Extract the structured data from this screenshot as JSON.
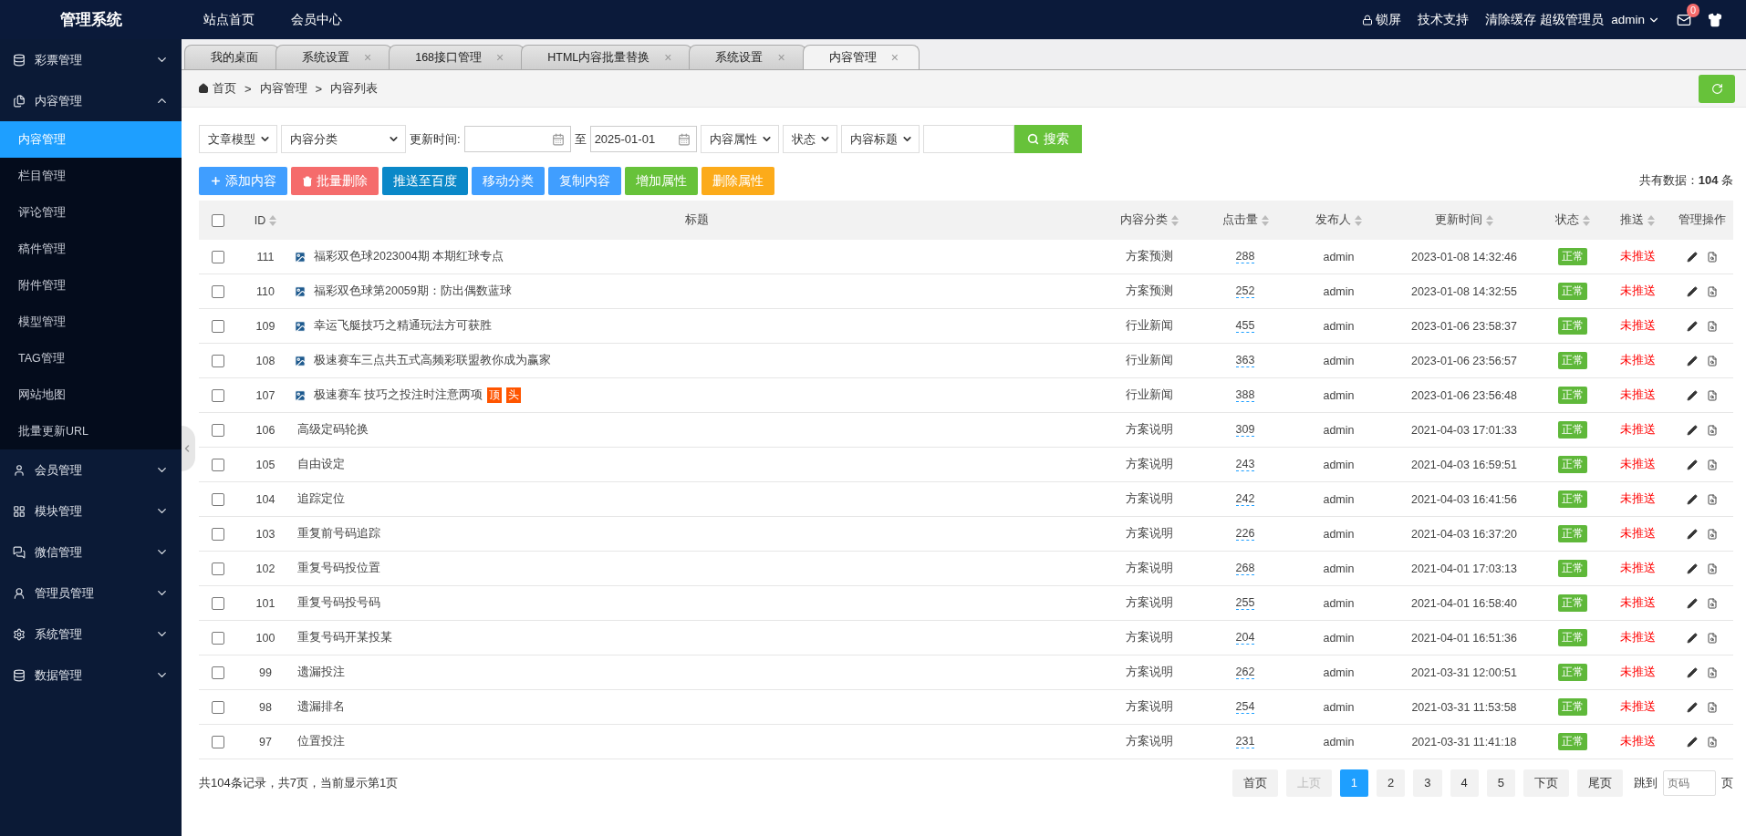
{
  "header": {
    "logo": "管理系统",
    "nav": [
      "站点首页",
      "会员中心"
    ],
    "lock": "锁屏",
    "links": [
      "技术支持",
      "清除缓存"
    ],
    "role": "超级管理员",
    "user": "admin",
    "mail_count": "0"
  },
  "sidebar": {
    "items": [
      {
        "label": "彩票管理",
        "expanded": false
      },
      {
        "label": "内容管理",
        "expanded": true,
        "children": [
          {
            "label": "内容管理",
            "selected": true
          },
          {
            "label": "栏目管理",
            "selected": false
          },
          {
            "label": "评论管理",
            "selected": false
          },
          {
            "label": "稿件管理",
            "selected": false
          },
          {
            "label": "附件管理",
            "selected": false
          },
          {
            "label": "模型管理",
            "selected": false
          },
          {
            "label": "TAG管理",
            "selected": false
          },
          {
            "label": "网站地图",
            "selected": false
          },
          {
            "label": "批量更新URL",
            "selected": false
          }
        ]
      },
      {
        "label": "会员管理",
        "expanded": false
      },
      {
        "label": "模块管理",
        "expanded": false
      },
      {
        "label": "微信管理",
        "expanded": false
      },
      {
        "label": "管理员管理",
        "expanded": false
      },
      {
        "label": "系统管理",
        "expanded": false
      },
      {
        "label": "数据管理",
        "expanded": false
      }
    ]
  },
  "tabs": [
    {
      "label": "我的桌面",
      "selected": false
    },
    {
      "label": "系统设置",
      "close": "×",
      "selected": false
    },
    {
      "label": "168接口管理",
      "close": "×",
      "selected": false
    },
    {
      "label": "HTML内容批量替换",
      "close": "×",
      "selected": false
    },
    {
      "label": "系统设置",
      "close": "×",
      "selected": false
    },
    {
      "label": "内容管理",
      "close": "×",
      "selected": true
    }
  ],
  "breadcrumb": {
    "items": [
      "首页",
      "内容管理",
      "内容列表"
    ],
    "separator": ">"
  },
  "filters": [
    {
      "kind": "select",
      "value": "文章模型",
      "wide": false
    },
    {
      "kind": "select",
      "value": "内容分类",
      "wide": true
    },
    {
      "kind": "label",
      "text": "更新时间:"
    },
    {
      "kind": "date"
    },
    {
      "kind": "label",
      "text": "至"
    },
    {
      "kind": "date",
      "value": "2025-01-01"
    },
    {
      "kind": "select",
      "value": "内容属性",
      "wide": false
    },
    {
      "kind": "select",
      "value": "状态",
      "wide": false
    },
    {
      "kind": "select",
      "value": "内容标题",
      "wide": false
    },
    {
      "kind": "text"
    },
    {
      "kind": "button",
      "label": "搜索"
    }
  ],
  "actions": [
    {
      "label": "添加内容",
      "kind": "add",
      "color": "#409eff"
    },
    {
      "label": "批量删除",
      "kind": "delete",
      "color": "#f56c6c"
    },
    {
      "label": "推送至百度",
      "kind": "plain",
      "color": "#0a88c8"
    },
    {
      "label": "移动分类",
      "kind": "plain",
      "color": "#409eff"
    },
    {
      "label": "复制内容",
      "kind": "plain",
      "color": "#409eff"
    },
    {
      "label": "增加属性",
      "kind": "plain",
      "color": "#67c23a"
    },
    {
      "label": "删除属性",
      "kind": "plain",
      "color": "#fcab1a"
    }
  ],
  "total": "共有数据：**104** 条",
  "table": {
    "select_all": false,
    "columns": [
      {
        "label": "ID",
        "sortable": true
      },
      {
        "label": "标题",
        "sortable": false
      },
      {
        "label": "内容分类",
        "sortable": true
      },
      {
        "label": "点击量",
        "sortable": true
      },
      {
        "label": "发布人",
        "sortable": true
      },
      {
        "label": "更新时间",
        "sortable": true
      },
      {
        "label": "状态",
        "sortable": true
      },
      {
        "label": "推送",
        "sortable": true
      },
      {
        "label": "管理操作",
        "sortable": false
      }
    ],
    "rows": [
      {
        "checked": false,
        "id": "111",
        "has_image": true,
        "title": "福彩双色球2023004期 本期红球专点",
        "category": "方案预测",
        "clicks": "288",
        "author": "admin",
        "updated": "2023-01-08 14:32:46",
        "status": "正常",
        "push": "未推送"
      },
      {
        "checked": false,
        "id": "110",
        "has_image": true,
        "title": "福彩双色球第20059期：防出偶数蓝球",
        "category": "方案预测",
        "clicks": "252",
        "author": "admin",
        "updated": "2023-01-08 14:32:55",
        "status": "正常",
        "push": "未推送"
      },
      {
        "checked": false,
        "id": "109",
        "has_image": true,
        "title": "幸运飞艇技巧之精通玩法方可获胜",
        "category": "行业新闻",
        "clicks": "455",
        "author": "admin",
        "updated": "2023-01-06 23:58:37",
        "status": "正常",
        "push": "未推送"
      },
      {
        "checked": false,
        "id": "108",
        "has_image": true,
        "title": "极速赛车三点共五式高频彩联盟教你成为赢家",
        "category": "行业新闻",
        "clicks": "363",
        "author": "admin",
        "updated": "2023-01-06 23:56:57",
        "status": "正常",
        "push": "未推送"
      },
      {
        "checked": false,
        "id": "107",
        "has_image": true,
        "title": "极速赛车 技巧之投注时注意两项",
        "tags": [
          "顶",
          "头"
        ],
        "category": "行业新闻",
        "clicks": "388",
        "author": "admin",
        "updated": "2023-01-06 23:56:48",
        "status": "正常",
        "push": "未推送"
      },
      {
        "checked": false,
        "id": "106",
        "has_image": false,
        "title": "高级定码轮换",
        "category": "方案说明",
        "clicks": "309",
        "author": "admin",
        "updated": "2021-04-03 17:01:33",
        "status": "正常",
        "push": "未推送"
      },
      {
        "checked": false,
        "id": "105",
        "has_image": false,
        "title": "自由设定",
        "category": "方案说明",
        "clicks": "243",
        "author": "admin",
        "updated": "2021-04-03 16:59:51",
        "status": "正常",
        "push": "未推送"
      },
      {
        "checked": false,
        "id": "104",
        "has_image": false,
        "title": "追踪定位",
        "category": "方案说明",
        "clicks": "242",
        "author": "admin",
        "updated": "2021-04-03 16:41:56",
        "status": "正常",
        "push": "未推送"
      },
      {
        "checked": false,
        "id": "103",
        "has_image": false,
        "title": "重复前号码追踪",
        "category": "方案说明",
        "clicks": "226",
        "author": "admin",
        "updated": "2021-04-03 16:37:20",
        "status": "正常",
        "push": "未推送"
      },
      {
        "checked": false,
        "id": "102",
        "has_image": false,
        "title": "重复号码投位置",
        "category": "方案说明",
        "clicks": "268",
        "author": "admin",
        "updated": "2021-04-01 17:03:13",
        "status": "正常",
        "push": "未推送"
      },
      {
        "checked": false,
        "id": "101",
        "has_image": false,
        "title": "重复号码投号码",
        "category": "方案说明",
        "clicks": "255",
        "author": "admin",
        "updated": "2021-04-01 16:58:40",
        "status": "正常",
        "push": "未推送"
      },
      {
        "checked": false,
        "id": "100",
        "has_image": false,
        "title": "重复号码开某投某",
        "category": "方案说明",
        "clicks": "204",
        "author": "admin",
        "updated": "2021-04-01 16:51:36",
        "status": "正常",
        "push": "未推送"
      },
      {
        "checked": false,
        "id": "99",
        "has_image": false,
        "title": "遗漏投注",
        "category": "方案说明",
        "clicks": "262",
        "author": "admin",
        "updated": "2021-03-31 12:00:51",
        "status": "正常",
        "push": "未推送"
      },
      {
        "checked": false,
        "id": "98",
        "has_image": false,
        "title": "遗漏排名",
        "category": "方案说明",
        "clicks": "254",
        "author": "admin",
        "updated": "2021-03-31 11:53:58",
        "status": "正常",
        "push": "未推送"
      },
      {
        "checked": false,
        "id": "97",
        "has_image": false,
        "title": "位置投注",
        "category": "方案说明",
        "clicks": "231",
        "author": "admin",
        "updated": "2021-03-31 11:41:18",
        "status": "正常",
        "push": "未推送"
      }
    ]
  },
  "footer": {
    "summary": "共104条记录，共7页，当前显示第1页",
    "pages": [
      {
        "label": "首页",
        "selected": false,
        "disabled": false
      },
      {
        "label": "上页",
        "selected": false,
        "disabled": true
      },
      {
        "label": "1",
        "selected": true,
        "disabled": false
      },
      {
        "label": "2",
        "selected": false,
        "disabled": false
      },
      {
        "label": "3",
        "selected": false,
        "disabled": false
      },
      {
        "label": "4",
        "selected": false,
        "disabled": false
      },
      {
        "label": "5",
        "selected": false,
        "disabled": false
      },
      {
        "label": "下页",
        "selected": false,
        "disabled": false
      },
      {
        "label": "尾页",
        "selected": false,
        "disabled": false
      }
    ],
    "jump_label": "跳到",
    "jump_placeholder": "页码",
    "jump_suffix": "页"
  }
}
